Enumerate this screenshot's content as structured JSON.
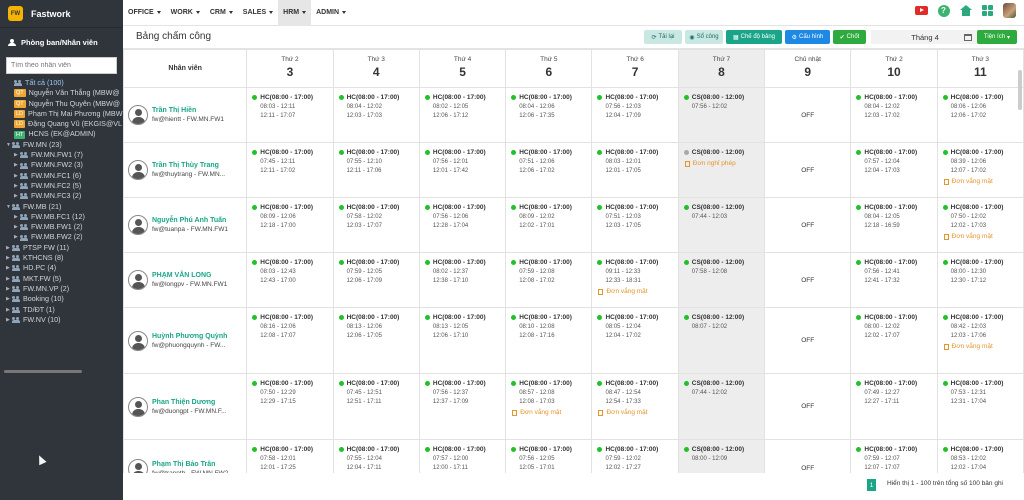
{
  "app": {
    "name": "Fastwork",
    "logo": "FW"
  },
  "sidebar": {
    "title": "Phòng ban/Nhân viên",
    "search_placeholder": "Tìm theo nhân viên",
    "tree": [
      {
        "level": 1,
        "type": "group",
        "label": "Tất cả (100)",
        "selected": true
      },
      {
        "level": 1,
        "badge": "QT",
        "badge_color": "#f0a733",
        "label": "Nguyễn Văn Thắng (MBW@"
      },
      {
        "level": 1,
        "badge": "QT",
        "badge_color": "#f0a733",
        "label": "Nguyễn Thu Quyên (MBW@"
      },
      {
        "level": 1,
        "badge": "LD",
        "badge_color": "#f0a733",
        "label": "Phạm Thị Mai Phương (MBW"
      },
      {
        "level": 1,
        "badge": "LD",
        "badge_color": "#f0a733",
        "label": "Đặng Quang Vũ (EKGIS@VL"
      },
      {
        "level": 1,
        "badge": "HT",
        "badge_color": "#3cb371",
        "label": "HCNS (EK@ADMIN)"
      },
      {
        "level": 0,
        "arrow": "▼",
        "type": "group",
        "label": "FW.MN (23)"
      },
      {
        "level": 1,
        "arrow": "▶",
        "type": "group",
        "label": "FW.MN.FW1 (7)"
      },
      {
        "level": 1,
        "arrow": "▶",
        "type": "group",
        "label": "FW.MN.FW2 (3)"
      },
      {
        "level": 1,
        "arrow": "▶",
        "type": "group",
        "label": "FW.MN.FC1 (6)"
      },
      {
        "level": 1,
        "arrow": "▶",
        "type": "group",
        "label": "FW.MN.FC2 (5)"
      },
      {
        "level": 1,
        "arrow": "▶",
        "type": "group",
        "label": "FW.MN.FC3 (2)"
      },
      {
        "level": 0,
        "arrow": "▼",
        "type": "group",
        "label": "FW.MB (21)"
      },
      {
        "level": 1,
        "arrow": "▶",
        "type": "group",
        "label": "FW.MB.FC1 (12)"
      },
      {
        "level": 1,
        "arrow": "▶",
        "type": "group",
        "label": "FW.MB.FW1 (2)"
      },
      {
        "level": 1,
        "arrow": "▶",
        "type": "group",
        "label": "FW.MB.FW2 (2)"
      },
      {
        "level": 0,
        "arrow": "▶",
        "type": "group",
        "label": "PTSP FW (11)"
      },
      {
        "level": 0,
        "arrow": "▶",
        "type": "group",
        "label": "KTHCNS (8)"
      },
      {
        "level": 0,
        "arrow": "▶",
        "type": "group",
        "label": "HD.PC (4)"
      },
      {
        "level": 0,
        "arrow": "▶",
        "type": "group",
        "label": "MKT.FW (5)"
      },
      {
        "level": 0,
        "arrow": "▶",
        "type": "group",
        "label": "FW.MN.VP (2)"
      },
      {
        "level": 0,
        "arrow": "▶",
        "type": "group",
        "label": "Booking (10)"
      },
      {
        "level": 0,
        "arrow": "▶",
        "type": "group",
        "label": "TD/ĐT (1)"
      },
      {
        "level": 0,
        "arrow": "▶",
        "type": "group",
        "label": "FW.NV (10)"
      }
    ]
  },
  "nav": [
    "OFFICE",
    "WORK",
    "CRM",
    "SALES",
    "HRM",
    "ADMIN"
  ],
  "nav_active": "HRM",
  "toolbar": {
    "title": "Bảng chấm công",
    "reload": "Tải lại",
    "worksheet": "Sổ công",
    "mode": "Chế độ bảng",
    "config": "Cấu hình",
    "lock": "Chốt",
    "month": "Tháng 4",
    "utilities": "Tiện ích"
  },
  "table": {
    "employee_header": "Nhân viên",
    "days": [
      {
        "name": "Thứ 2",
        "num": "3"
      },
      {
        "name": "Thứ 3",
        "num": "4"
      },
      {
        "name": "Thứ 4",
        "num": "5"
      },
      {
        "name": "Thứ 5",
        "num": "6"
      },
      {
        "name": "Thứ 6",
        "num": "7"
      },
      {
        "name": "Thứ 7",
        "num": "8"
      },
      {
        "name": "Chủ nhật",
        "num": "9"
      },
      {
        "name": "Thứ 2",
        "num": "10"
      },
      {
        "name": "Thứ 3",
        "num": "11"
      }
    ],
    "rows": [
      {
        "name": "Trần Thị Hiền",
        "account": "fw@hientt - FW.MN.FW1",
        "cells": [
          {
            "shift": "HC(08:00 - 17:00)",
            "times": [
              "08:03 - 12:11",
              "12:11 - 17:07"
            ]
          },
          {
            "shift": "HC(08:00 - 17:00)",
            "times": [
              "08:04 - 12:02",
              "12:03 - 17:03"
            ]
          },
          {
            "shift": "HC(08:00 - 17:00)",
            "times": [
              "08:02 - 12:05",
              "12:06 - 17:12"
            ]
          },
          {
            "shift": "HC(08:00 - 17:00)",
            "times": [
              "08:04 - 12:06",
              "12:06 - 17:35"
            ]
          },
          {
            "shift": "HC(08:00 - 17:00)",
            "times": [
              "07:56 - 12:03",
              "12:04 - 17:09"
            ]
          },
          {
            "shift": "CS(08:00 - 12:00)",
            "times": [
              "07:56 - 12:02"
            ]
          },
          {
            "off": "OFF"
          },
          {
            "shift": "HC(08:00 - 17:00)",
            "times": [
              "08:04 - 12:02",
              "12:03 - 17:02"
            ]
          },
          {
            "shift": "HC(08:00 - 17:00)",
            "times": [
              "08:06 - 12:06",
              "12:06 - 17:02"
            ]
          }
        ]
      },
      {
        "name": "Trần Thị Thùy Trang",
        "account": "fw@thuytrang - FW.MN...",
        "cells": [
          {
            "shift": "HC(08:00 - 17:00)",
            "times": [
              "07:45 - 12:11",
              "12:11 - 17:02"
            ]
          },
          {
            "shift": "HC(08:00 - 17:00)",
            "times": [
              "07:55 - 12:10",
              "12:11 - 17:06"
            ]
          },
          {
            "shift": "HC(08:00 - 17:00)",
            "times": [
              "07:56 - 12:01",
              "12:01 - 17:42"
            ]
          },
          {
            "shift": "HC(08:00 - 17:00)",
            "times": [
              "07:51 - 12:06",
              "12:06 - 17:02"
            ]
          },
          {
            "shift": "HC(08:00 - 17:00)",
            "times": [
              "08:03 - 12:01",
              "12:01 - 17:05"
            ]
          },
          {
            "shift": "CS(08:00 - 12:00)",
            "gray": true,
            "request": "Đơn nghỉ phép"
          },
          {
            "off": "OFF"
          },
          {
            "shift": "HC(08:00 - 17:00)",
            "times": [
              "07:57 - 12:04",
              "12:04 - 17:03"
            ]
          },
          {
            "shift": "HC(08:00 - 17:00)",
            "times": [
              "08:39 - 12:06",
              "12:07 - 17:02"
            ],
            "request": "Đơn vắng mặt"
          }
        ]
      },
      {
        "name": "Nguyễn Phú Anh Tuấn",
        "account": "fw@tuanpa - FW.MN.FW1",
        "cells": [
          {
            "shift": "HC(08:00 - 17:00)",
            "times": [
              "08:09 - 12:06",
              "12:18 - 17:00"
            ]
          },
          {
            "shift": "HC(08:00 - 17:00)",
            "times": [
              "07:58 - 12:02",
              "12:03 - 17:07"
            ]
          },
          {
            "shift": "HC(08:00 - 17:00)",
            "times": [
              "07:56 - 12:06",
              "12:28 - 17:04"
            ]
          },
          {
            "shift": "HC(08:00 - 17:00)",
            "times": [
              "08:09 - 12:02",
              "12:02 - 17:01"
            ]
          },
          {
            "shift": "HC(08:00 - 17:00)",
            "times": [
              "07:51 - 12:03",
              "12:03 - 17:05"
            ]
          },
          {
            "shift": "CS(08:00 - 12:00)",
            "times": [
              "07:44 - 12:03"
            ]
          },
          {
            "off": "OFF"
          },
          {
            "shift": "HC(08:00 - 17:00)",
            "times": [
              "08:04 - 12:05",
              "12:18 - 16:59"
            ]
          },
          {
            "shift": "HC(08:00 - 17:00)",
            "times": [
              "07:50 - 12:02",
              "12:02 - 17:03"
            ],
            "request": "Đơn vắng mặt"
          }
        ]
      },
      {
        "name": "PHẠM VĂN LONG",
        "account": "fw@longpv - FW.MN.FW1",
        "cells": [
          {
            "shift": "HC(08:00 - 17:00)",
            "times": [
              "08:03 - 12:43",
              "12:43 - 17:00"
            ]
          },
          {
            "shift": "HC(08:00 - 17:00)",
            "times": [
              "07:59 - 12:05",
              "12:06 - 17:09"
            ]
          },
          {
            "shift": "HC(08:00 - 17:00)",
            "times": [
              "08:02 - 12:37",
              "12:38 - 17:10"
            ]
          },
          {
            "shift": "HC(08:00 - 17:00)",
            "times": [
              "07:59 - 12:08",
              "12:08 - 17:02"
            ]
          },
          {
            "shift": "HC(08:00 - 17:00)",
            "times": [
              "09:11 - 12:33",
              "12:33 - 18:31"
            ],
            "request": "Đơn vắng mặt"
          },
          {
            "shift": "CS(08:00 - 12:00)",
            "times": [
              "07:58 - 12:08"
            ]
          },
          {
            "off": "OFF"
          },
          {
            "shift": "HC(08:00 - 17:00)",
            "times": [
              "07:56 - 12:41",
              "12:41 - 17:32"
            ]
          },
          {
            "shift": "HC(08:00 - 17:00)",
            "times": [
              "08:00 - 12:30",
              "12:30 - 17:12"
            ]
          }
        ]
      },
      {
        "name": "Huỳnh Phương Quỳnh",
        "account": "fw@phuongquynh - FW...",
        "cells": [
          {
            "shift": "HC(08:00 - 17:00)",
            "times": [
              "08:16 - 12:06",
              "12:08 - 17:07"
            ]
          },
          {
            "shift": "HC(08:00 - 17:00)",
            "times": [
              "08:13 - 12:06",
              "12:06 - 17:05"
            ]
          },
          {
            "shift": "HC(08:00 - 17:00)",
            "times": [
              "08:13 - 12:05",
              "12:06 - 17:10"
            ]
          },
          {
            "shift": "HC(08:00 - 17:00)",
            "times": [
              "08:10 - 12:08",
              "12:08 - 17:16"
            ]
          },
          {
            "shift": "HC(08:00 - 17:00)",
            "times": [
              "08:05 - 12:04",
              "12:04 - 17:02"
            ]
          },
          {
            "shift": "CS(08:00 - 12:00)",
            "times": [
              "08:07 - 12:02"
            ]
          },
          {
            "off": "OFF"
          },
          {
            "shift": "HC(08:00 - 17:00)",
            "times": [
              "08:00 - 12:02",
              "12:02 - 17:07"
            ]
          },
          {
            "shift": "HC(08:00 - 17:00)",
            "times": [
              "08:42 - 12:03",
              "12:03 - 17:06"
            ],
            "request": "Đơn vắng mặt"
          }
        ]
      },
      {
        "name": "Phan Thiện Dương",
        "account": "fw@duongpt - FW.MN.F...",
        "cells": [
          {
            "shift": "HC(08:00 - 17:00)",
            "times": [
              "07:50 - 12:29",
              "12:29 - 17:15"
            ]
          },
          {
            "shift": "HC(08:00 - 17:00)",
            "times": [
              "07:45 - 12:51",
              "12:51 - 17:11"
            ]
          },
          {
            "shift": "HC(08:00 - 17:00)",
            "times": [
              "07:56 - 12:37",
              "12:37 - 17:09"
            ]
          },
          {
            "shift": "HC(08:00 - 17:00)",
            "times": [
              "08:57 - 12:08",
              "12:08 - 17:03"
            ],
            "request": "Đơn vắng mặt"
          },
          {
            "shift": "HC(08:00 - 17:00)",
            "times": [
              "08:47 - 12:54",
              "12:54 - 17:33"
            ],
            "request": "Đơn vắng mặt"
          },
          {
            "shift": "CS(08:00 - 12:00)",
            "times": [
              "07:44 - 12:02"
            ]
          },
          {
            "off": "OFF"
          },
          {
            "shift": "HC(08:00 - 17:00)",
            "times": [
              "07:49 - 12:27",
              "12:27 - 17:11"
            ]
          },
          {
            "shift": "HC(08:00 - 17:00)",
            "times": [
              "07:53 - 12:31",
              "12:31 - 17:04"
            ]
          }
        ]
      },
      {
        "name": "Phạm Thị Bảo Trân",
        "account": "fw@tranptb - FW.MN.FW2",
        "cells": [
          {
            "shift": "HC(08:00 - 17:00)",
            "times": [
              "07:58 - 12:01",
              "12:01 - 17:25"
            ]
          },
          {
            "shift": "HC(08:00 - 17:00)",
            "times": [
              "07:55 - 12:04",
              "12:04 - 17:11"
            ]
          },
          {
            "shift": "HC(08:00 - 17:00)",
            "times": [
              "07:57 - 12:00",
              "12:00 - 17:11"
            ]
          },
          {
            "shift": "HC(08:00 - 17:00)",
            "times": [
              "07:56 - 12:05",
              "12:05 - 17:01"
            ]
          },
          {
            "shift": "HC(08:00 - 17:00)",
            "times": [
              "07:59 - 12:02",
              "12:02 - 17:27"
            ]
          },
          {
            "shift": "CS(08:00 - 12:00)",
            "times": [
              "08:00 - 12:09"
            ]
          },
          {
            "off": "OFF"
          },
          {
            "shift": "HC(08:00 - 17:00)",
            "times": [
              "07:59 - 12:07",
              "12:07 - 17:07"
            ]
          },
          {
            "shift": "HC(08:00 - 17:00)",
            "times": [
              "08:53 - 12:02",
              "12:02 - 17:04"
            ],
            "request": "Đơn vắng mặt"
          }
        ]
      }
    ]
  },
  "footer": {
    "page": "1",
    "info": "Hiển thị 1 - 100 trên tổng số 100 bản ghi"
  },
  "colors": {
    "accent": "#1aa589",
    "present": "#22c02a",
    "request": "#e5952a",
    "sidebar": "#2f353b"
  }
}
